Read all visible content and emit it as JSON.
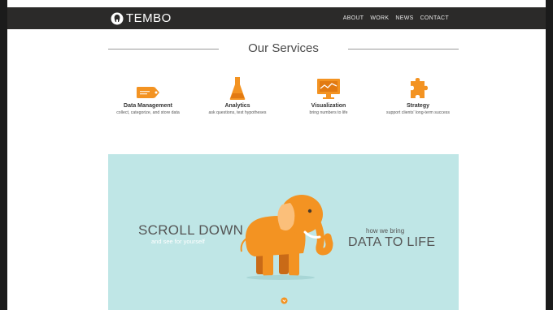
{
  "header": {
    "logo_text": "TEMBO",
    "nav": [
      "ABOUT",
      "WORK",
      "NEWS",
      "CONTACT"
    ]
  },
  "services": {
    "title": "Our Services",
    "items": [
      {
        "name": "Data Management",
        "desc": "collect, categorize, and store data",
        "icon": "tag-icon"
      },
      {
        "name": "Analytics",
        "desc": "ask questions, test hypotheses",
        "icon": "flask-icon"
      },
      {
        "name": "Visualization",
        "desc": "bring numbers to life",
        "icon": "monitor-chart-icon"
      },
      {
        "name": "Strategy",
        "desc": "support clients' long-term success",
        "icon": "puzzle-icon"
      }
    ]
  },
  "hero": {
    "scroll_title": "SCROLL DOWN",
    "scroll_sub": "and see for yourself",
    "how": "how we bring",
    "data_life": "DATA TO LIFE"
  },
  "colors": {
    "accent_orange": "#f39322",
    "topbar": "#2b2a29",
    "hero_bg": "#bfe6e6"
  }
}
